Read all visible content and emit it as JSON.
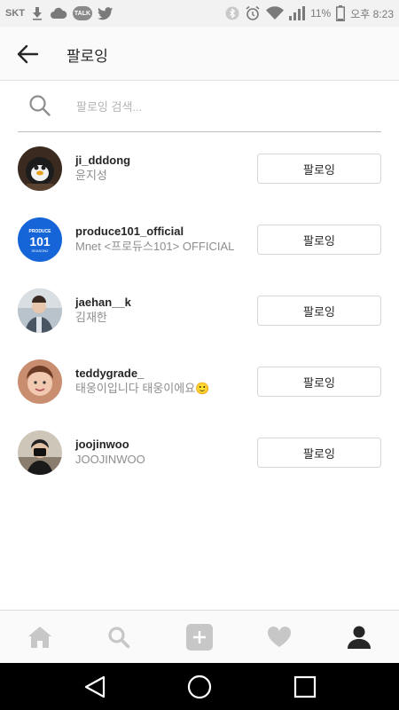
{
  "status_bar": {
    "carrier": "SKT",
    "talk_badge": "TALK",
    "battery": "11%",
    "time": "오후 8:23",
    "icons": [
      "download-icon",
      "cloud-icon",
      "talk-icon",
      "twitter-icon",
      "bluetooth-icon",
      "alarm-icon",
      "wifi-icon",
      "signal-icon",
      "battery-icon"
    ]
  },
  "header": {
    "title": "팔로잉",
    "back_icon": "arrow-left-icon"
  },
  "search": {
    "placeholder": "팔로잉 검색..."
  },
  "following": [
    {
      "username": "ji_dddong",
      "full_name": "윤지성",
      "button": "팔로잉",
      "avatar_color": "#3a2a1f"
    },
    {
      "username": "produce101_official",
      "full_name": "Mnet <프로듀스101> OFFICIAL",
      "button": "팔로잉",
      "avatar_color": "#1565d8",
      "avatar_text_top": "PRODUCE",
      "avatar_text_main": "101",
      "avatar_text_bottom": "SEASON2"
    },
    {
      "username": "jaehan__k",
      "full_name": "김재한",
      "button": "팔로잉",
      "avatar_color": "#6f7d8c"
    },
    {
      "username": "teddygrade_",
      "full_name": "태웅이입니다 태웅이에요",
      "button": "팔로잉",
      "avatar_color": "#c98d6f",
      "emoji": "🙂"
    },
    {
      "username": "joojinwoo",
      "full_name": "JOOJINWOO",
      "button": "팔로잉",
      "avatar_color": "#9c8f80"
    }
  ],
  "bottom_nav": {
    "items": [
      "home-icon",
      "search-icon",
      "add-icon",
      "heart-icon",
      "profile-icon"
    ],
    "active": "profile-icon"
  },
  "android_nav": [
    "back-triangle-icon",
    "home-circle-icon",
    "recents-square-icon"
  ]
}
